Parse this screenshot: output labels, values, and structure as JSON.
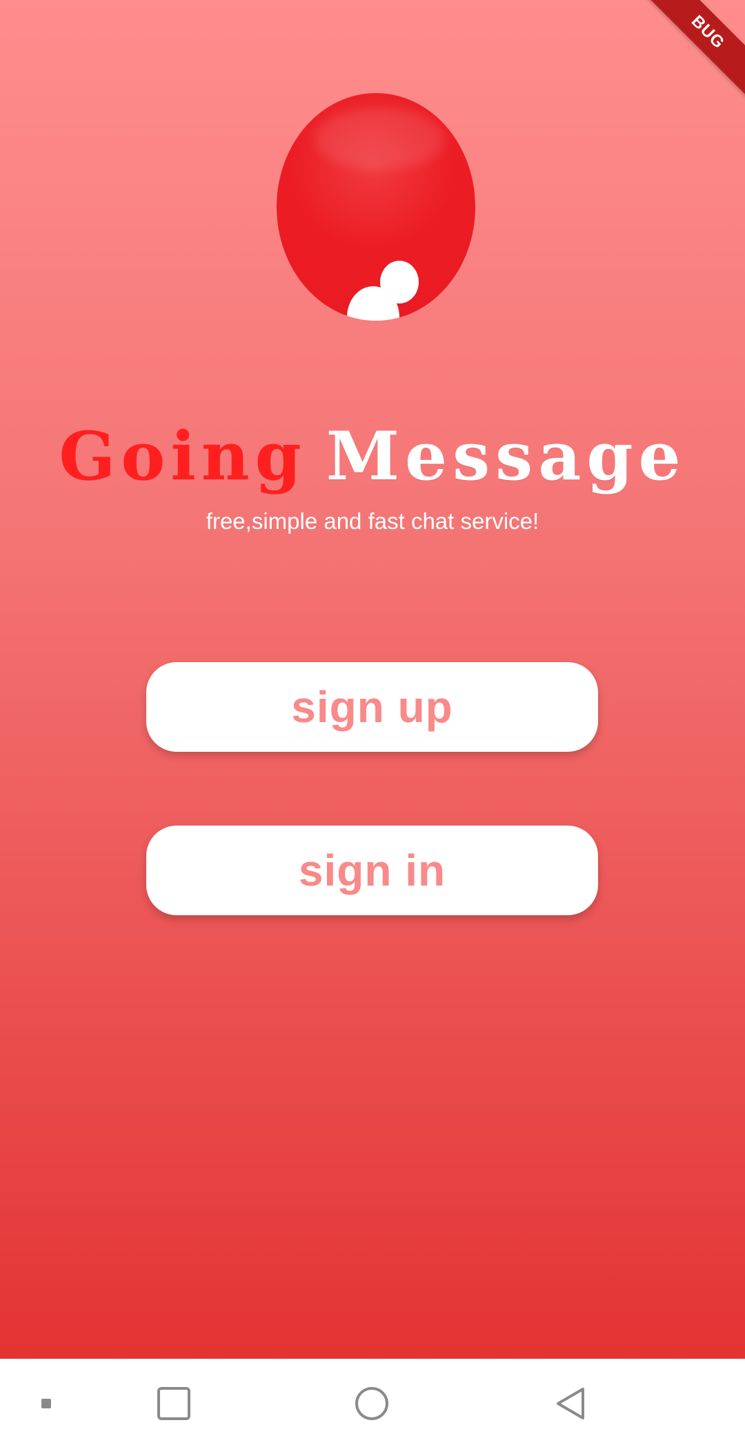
{
  "app": {
    "title_part_1": "Going",
    "title_part_2": "Message",
    "tagline": "free,simple and fast chat service!"
  },
  "debug_banner": {
    "label": "BUG"
  },
  "buttons": {
    "sign_up_label": "sign up",
    "sign_in_label": "sign in"
  },
  "icons": {
    "logo": "chat-person-logo-icon",
    "nav_menu": "menu-dots-icon",
    "nav_recents": "recent-apps-square-icon",
    "nav_home": "home-circle-icon",
    "nav_back": "back-triangle-icon"
  },
  "colors": {
    "background_top": "#ff8d8d",
    "background_bottom": "#e33333",
    "logo_red": "#ec1c24",
    "title_red": "#ff1f1f",
    "button_text": "#f98a8a",
    "white": "#ffffff",
    "nav_icon_gray": "#8a8a8a"
  }
}
